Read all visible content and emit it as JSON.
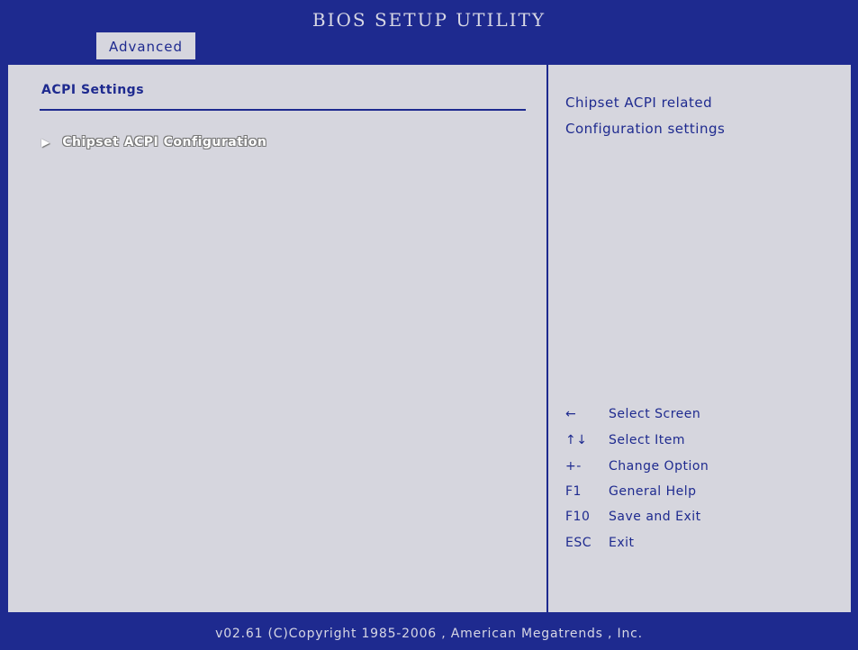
{
  "header": {
    "title": "BIOS SETUP UTILITY",
    "tabs": [
      {
        "label": "Advanced",
        "active": true
      }
    ]
  },
  "main": {
    "section_title": "ACPI Settings",
    "items": [
      {
        "label": "Chipset ACPI Configuration",
        "arrow": "▶"
      }
    ]
  },
  "help": {
    "lines": [
      "Chipset ACPI related",
      "Configuration settings"
    ],
    "keys": [
      {
        "key": "←",
        "desc": "Select Screen"
      },
      {
        "key": "↑↓",
        "desc": "Select Item"
      },
      {
        "key": "+-",
        "desc": "Change Option"
      },
      {
        "key": "F1",
        "desc": "General Help"
      },
      {
        "key": "F10",
        "desc": "Save and Exit"
      },
      {
        "key": "ESC",
        "desc": "Exit"
      }
    ]
  },
  "footer": {
    "text": "v02.61 (C)Copyright 1985-2006 , American Megatrends , Inc."
  },
  "colors": {
    "background": "#1e2a8f",
    "panel": "#d6d6de",
    "text": "#1e2a8f",
    "highlight": "#ffffff"
  }
}
